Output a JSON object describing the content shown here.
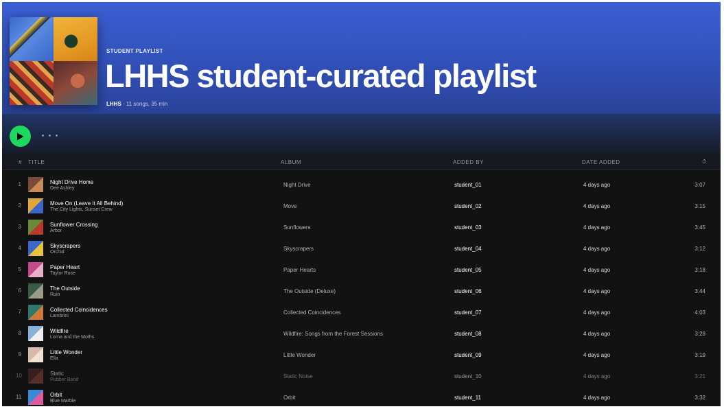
{
  "playlist": {
    "type_label": "STUDENT PLAYLIST",
    "title": "LHHS student-curated playlist",
    "owner": "LHHS",
    "meta_rest": "· 11 songs, 35 min"
  },
  "actions": {
    "play_icon": "play-icon",
    "more_icon": "more-options-icon"
  },
  "table": {
    "headers": {
      "num": "#",
      "title": "TITLE",
      "album": "ALBUM",
      "added_by": "ADDED BY",
      "date_added": "DATE ADDED",
      "duration": "⏱"
    },
    "rows": [
      {
        "num": "1",
        "title": "Night Drive Home",
        "artist": "Dee Ashley",
        "album": "Night Drive",
        "added_by": "student_01",
        "date_added": "4 days ago",
        "duration": "3:07",
        "art": [
          "#7a4a3a",
          "#c98a5a"
        ]
      },
      {
        "num": "2",
        "title": "Move On (Leave It All Behind)",
        "artist": "The City Lights, Sunset Crew",
        "album": "Move",
        "added_by": "student_02",
        "date_added": "4 days ago",
        "duration": "3:15",
        "art": [
          "#e0a63a",
          "#3a67c9"
        ]
      },
      {
        "num": "3",
        "title": "Sunflower Crossing",
        "artist": "Arbor",
        "album": "Sunflowers",
        "added_by": "student_03",
        "date_added": "4 days ago",
        "duration": "3:45",
        "art": [
          "#6a8a3a",
          "#b83a2a"
        ]
      },
      {
        "num": "4",
        "title": "Skyscrapers",
        "artist": "Orchid",
        "album": "Skyscrapers",
        "added_by": "student_04",
        "date_added": "4 days ago",
        "duration": "3:12",
        "art": [
          "#3a67c9",
          "#e7c23d"
        ]
      },
      {
        "num": "5",
        "title": "Paper Heart",
        "artist": "Taylor Rose",
        "album": "Paper Hearts",
        "added_by": "student_05",
        "date_added": "4 days ago",
        "duration": "3:18",
        "art": [
          "#c04a8a",
          "#e6b0c8"
        ]
      },
      {
        "num": "6",
        "title": "The Outside",
        "artist": "Ruin",
        "album": "The Outside (Deluxe)",
        "added_by": "student_06",
        "date_added": "4 days ago",
        "duration": "3:44",
        "art": [
          "#3a5a4a",
          "#9a9a8a"
        ]
      },
      {
        "num": "7",
        "title": "Collected Coincidences",
        "artist": "Lambrini",
        "album": "Collected Coincidences",
        "added_by": "student_07",
        "date_added": "4 days ago",
        "duration": "4:03",
        "art": [
          "#2a7a6a",
          "#d07a3a"
        ]
      },
      {
        "num": "8",
        "title": "Wildfire",
        "artist": "Lorna and the Moths",
        "album": "Wildfire: Songs from the Forest Sessions",
        "added_by": "student_08",
        "date_added": "4 days ago",
        "duration": "3:28",
        "art": [
          "#8ab0d8",
          "#f0f0f0"
        ]
      },
      {
        "num": "9",
        "title": "Little Wonder",
        "artist": "Ella",
        "album": "Little Wonder",
        "added_by": "student_09",
        "date_added": "4 days ago",
        "duration": "3:19",
        "art": [
          "#d8b8a8",
          "#f2e2d2"
        ]
      },
      {
        "num": "10",
        "title": "Static",
        "artist": "Rubber Band",
        "album": "Static Noise",
        "added_by": "student_10",
        "date_added": "4 days ago",
        "duration": "3:21",
        "art": [
          "#5a2a2a",
          "#8a4a3a"
        ],
        "fade": true
      },
      {
        "num": "11",
        "title": "Orbit",
        "artist": "Blue Marble",
        "album": "Orbit",
        "added_by": "student_11",
        "date_added": "4 days ago",
        "duration": "3:32",
        "art": [
          "#3a8ad8",
          "#e05aa0"
        ]
      }
    ]
  }
}
